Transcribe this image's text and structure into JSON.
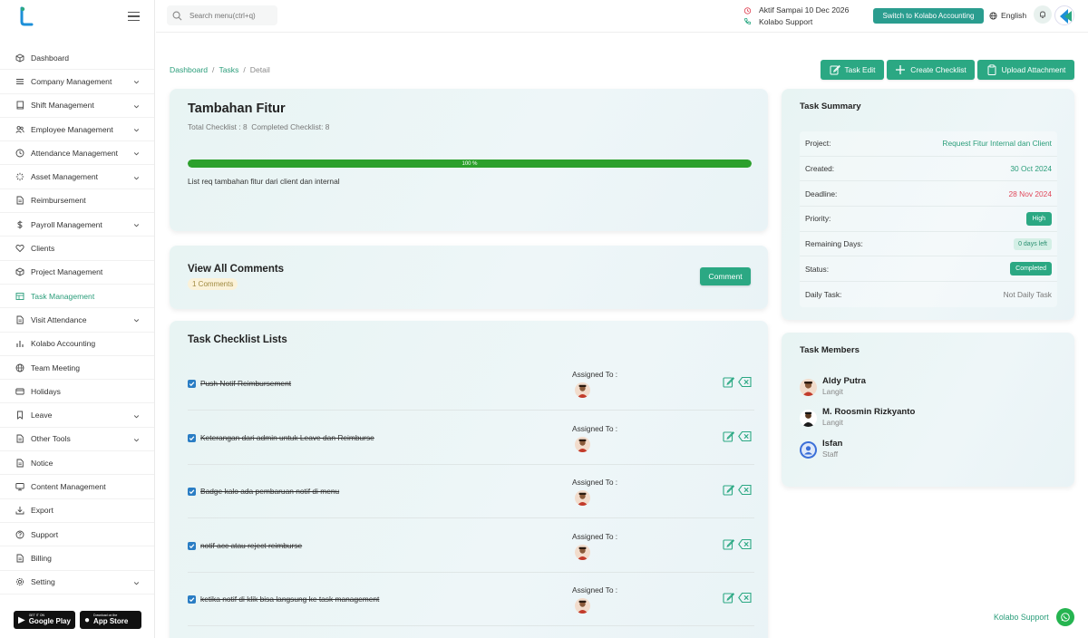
{
  "topbar": {
    "search_placeholder": "Search menu(ctrl+q)",
    "active_until": "Aktif Sampai 10 Dec 2026",
    "support_label": "Kolabo Support",
    "switch_button": "Switch to Kolabo Accounting",
    "language": "English"
  },
  "sidebar": {
    "items": [
      {
        "label": "Dashboard",
        "icon": "cube-icon",
        "expandable": false
      },
      {
        "label": "Company Management",
        "icon": "list-icon",
        "expandable": true
      },
      {
        "label": "Shift Management",
        "icon": "book-icon",
        "expandable": true
      },
      {
        "label": "Employee Management",
        "icon": "users-icon",
        "expandable": true
      },
      {
        "label": "Attendance Management",
        "icon": "clock-icon",
        "expandable": true
      },
      {
        "label": "Asset Management",
        "icon": "loader-icon",
        "expandable": true
      },
      {
        "label": "Reimbursement",
        "icon": "file-icon",
        "expandable": false
      },
      {
        "label": "Payroll Management",
        "icon": "dollar-icon",
        "expandable": true
      },
      {
        "label": "Clients",
        "icon": "heart-icon",
        "expandable": false
      },
      {
        "label": "Project Management",
        "icon": "box-icon",
        "expandable": false
      },
      {
        "label": "Task Management",
        "icon": "table-icon",
        "expandable": false
      },
      {
        "label": "Visit Attendance",
        "icon": "file-text-icon",
        "expandable": true
      },
      {
        "label": "Kolabo Accounting",
        "icon": "bar-chart-icon",
        "expandable": false
      },
      {
        "label": "Team Meeting",
        "icon": "globe-icon",
        "expandable": false
      },
      {
        "label": "Holidays",
        "icon": "credit-card-icon",
        "expandable": false
      },
      {
        "label": "Leave",
        "icon": "bookmark-icon",
        "expandable": true
      },
      {
        "label": "Other Tools",
        "icon": "file-icon",
        "expandable": true
      },
      {
        "label": "Notice",
        "icon": "file-icon",
        "expandable": false
      },
      {
        "label": "Content Management",
        "icon": "monitor-icon",
        "expandable": false
      },
      {
        "label": "Export",
        "icon": "download-icon",
        "expandable": false
      },
      {
        "label": "Support",
        "icon": "help-circle-icon",
        "expandable": false
      },
      {
        "label": "Billing",
        "icon": "file-icon",
        "expandable": false
      },
      {
        "label": "Setting",
        "icon": "gear-icon",
        "expandable": true
      }
    ],
    "active_index": 10,
    "google_play_small": "GET IT ON",
    "google_play_big": "Google Play",
    "app_store_small": "Download on the",
    "app_store_big": "App Store"
  },
  "breadcrumb": {
    "items": [
      "Dashboard",
      "Tasks",
      "Detail"
    ],
    "separator": "/"
  },
  "actions": {
    "task_edit": "Task Edit",
    "create_checklist": "Create Checklist",
    "upload_attachment": "Upload Attachment"
  },
  "task": {
    "title": "Tambahan Fitur",
    "total_checklist": "Total Checklist : 8",
    "completed_checklist": "Completed Checklist: 8",
    "progress_label": "100 %",
    "progress_fraction": 1.0,
    "description": "List req tambahan fitur dari client dan internal"
  },
  "comments": {
    "title": "View All Comments",
    "count_label": "1 Comments",
    "button": "Comment"
  },
  "checklist": {
    "title": "Task Checklist Lists",
    "assigned_label": "Assigned To :",
    "items": [
      {
        "text": "Push Notif Reimbursement",
        "done": true
      },
      {
        "text": "Keterangan dari admin untuk Leave dan Reimburse",
        "done": true
      },
      {
        "text": "Badge kalo ada pembaruan notif di menu",
        "done": true
      },
      {
        "text": "notif acc atau reject reimburse",
        "done": true
      },
      {
        "text": "ketika notif di klik bisa langsung ke task management",
        "done": true
      }
    ]
  },
  "summary": {
    "title": "Task Summary",
    "project_label": "Project:",
    "project_value": "Request Fitur Internal dan Client",
    "created_label": "Created:",
    "created_value": "30 Oct 2024",
    "deadline_label": "Deadline:",
    "deadline_value": "28 Nov 2024",
    "priority_label": "Priority:",
    "priority_value": "High",
    "remaining_label": "Remaining Days:",
    "remaining_value": "0 days left",
    "status_label": "Status:",
    "status_value": "Completed",
    "daily_label": "Daily Task:",
    "daily_value": "Not Daily Task"
  },
  "members": {
    "title": "Task Members",
    "items": [
      {
        "name": "Aldy Putra",
        "role": "Langit"
      },
      {
        "name": "M. Roosmin Rizkyanto",
        "role": "Langit"
      },
      {
        "name": "Isfan",
        "role": "Staff"
      }
    ]
  },
  "floating_support": "Kolabo Support",
  "colors": {
    "accent": "#2ba883",
    "link": "#2a9d7a",
    "progress": "#2ca02c",
    "deadline": "#e0475a",
    "checkbox": "#2a7dc4"
  }
}
